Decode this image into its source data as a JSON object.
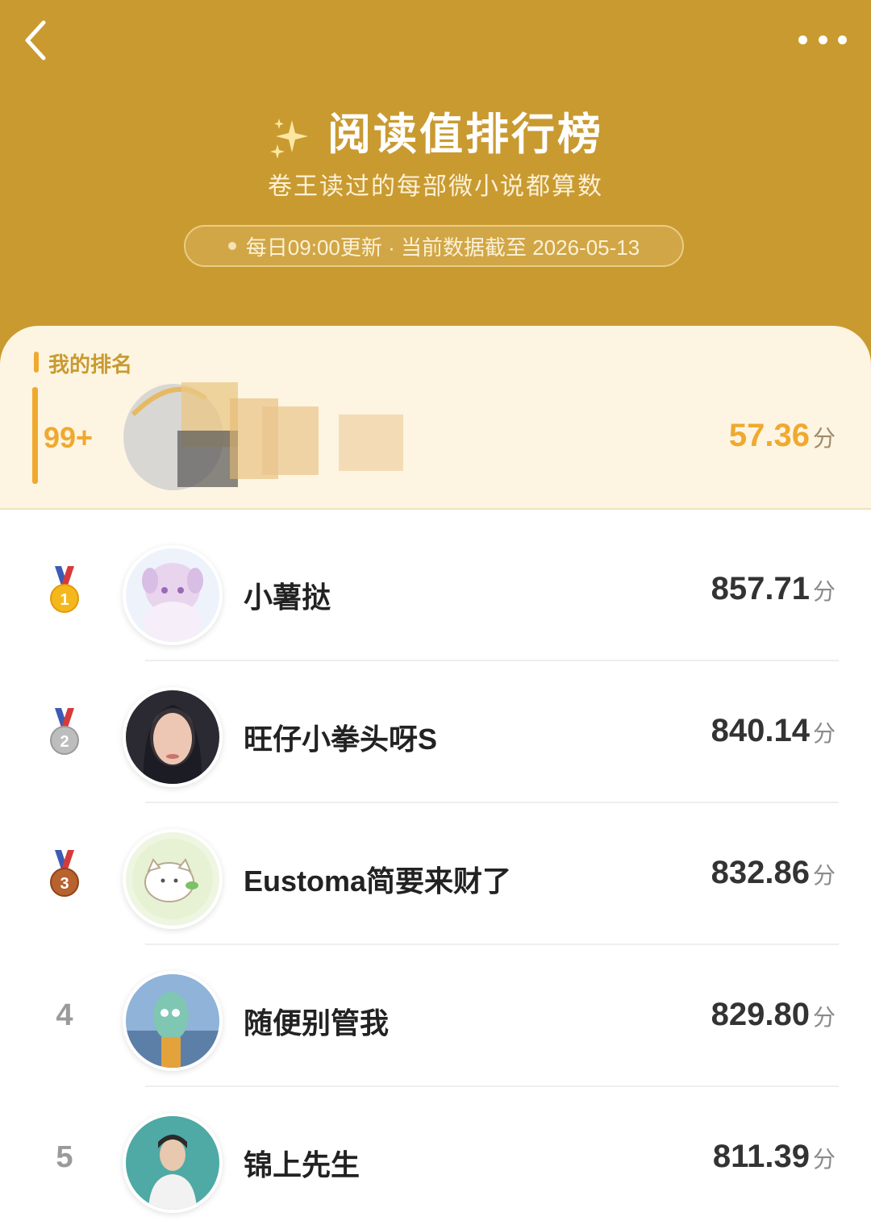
{
  "header": {
    "title": "阅读值排行榜",
    "subtitle": "卷王读过的每部微小说都算数",
    "update_text": "每日09:00更新 · 当前数据截至 2026-05-13",
    "back_icon": "chevron-left-icon",
    "more_icon": "more-dots-icon",
    "title_icon": "sparkles-icon"
  },
  "my_rank": {
    "label": "我的排名",
    "rank": "99+",
    "score": "57.36",
    "unit": "分"
  },
  "leaderboard": [
    {
      "rank": "1",
      "name": "小薯挞",
      "score": "857.71",
      "unit": "分",
      "badge": "gold-medal"
    },
    {
      "rank": "2",
      "name": "旺仔小拳头呀S",
      "score": "840.14",
      "unit": "分",
      "badge": "silver-medal"
    },
    {
      "rank": "3",
      "name": "Eustoma简要来财了",
      "score": "832.86",
      "unit": "分",
      "badge": "bronze-medal"
    },
    {
      "rank": "4",
      "name": "随便别管我",
      "score": "829.80",
      "unit": "分"
    },
    {
      "rank": "5",
      "name": "锦上先生",
      "score": "811.39",
      "unit": "分"
    }
  ],
  "colors": {
    "header_bg": "#c99a30",
    "accent": "#f0a92e",
    "card_bg": "#fdf5e2"
  }
}
